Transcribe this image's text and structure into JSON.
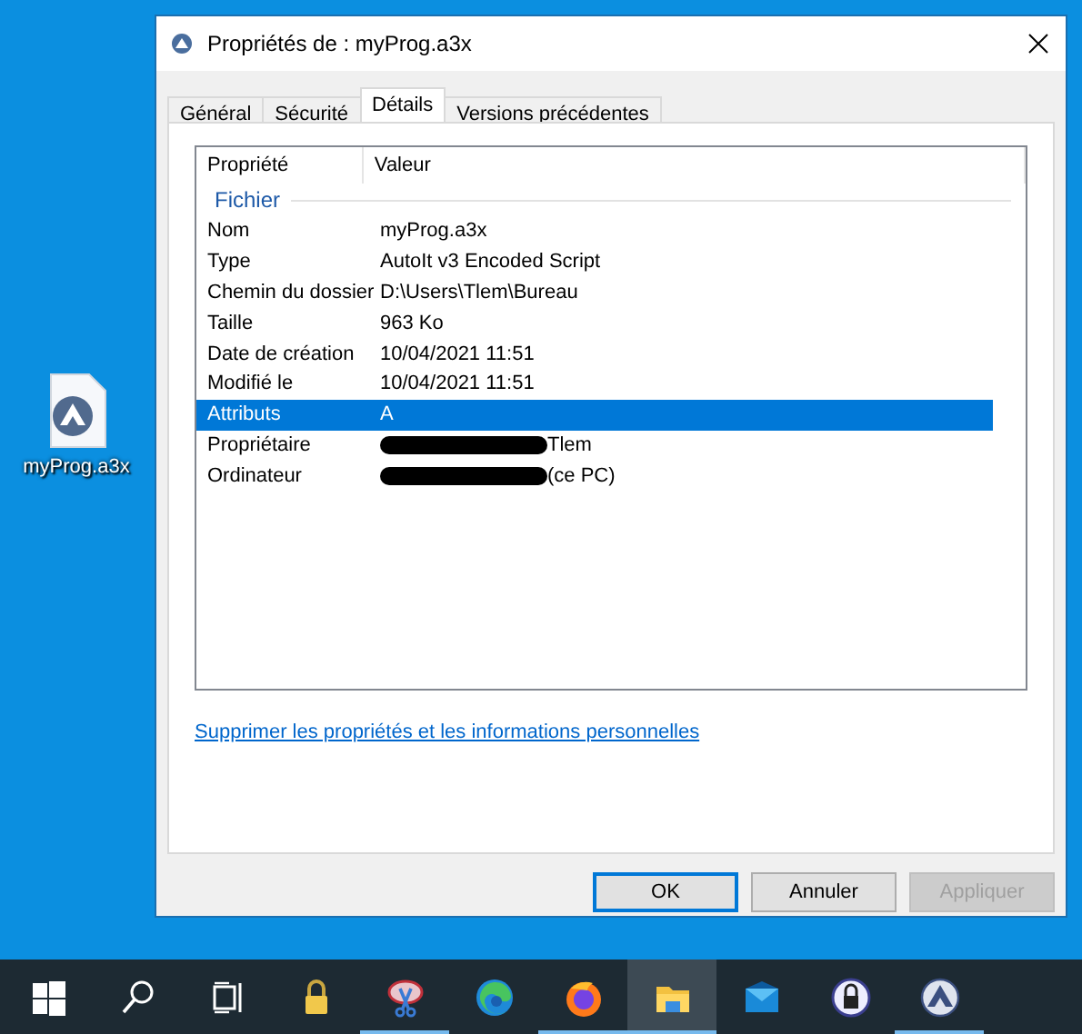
{
  "desktop_icon": {
    "label": "myProg.a3x"
  },
  "window": {
    "title": "Propriétés de : myProg.a3x"
  },
  "tabs": [
    {
      "label": "Général",
      "selected": false
    },
    {
      "label": "Sécurité",
      "selected": false
    },
    {
      "label": "Détails",
      "selected": true
    },
    {
      "label": "Versions précédentes",
      "selected": false
    }
  ],
  "table": {
    "columns": [
      "Propriété",
      "Valeur"
    ],
    "group": "Fichier",
    "rows": [
      {
        "name": "Nom",
        "value": "myProg.a3x",
        "selected": false,
        "redacted": false
      },
      {
        "name": "Type",
        "value": "AutoIt v3 Encoded Script",
        "selected": false,
        "redacted": false
      },
      {
        "name": "Chemin du dossier",
        "value": "D:\\Users\\Tlem\\Bureau",
        "selected": false,
        "redacted": false
      },
      {
        "name": "Taille",
        "value": "963 Ko",
        "selected": false,
        "redacted": false
      },
      {
        "name": "Date de création",
        "value": "10/04/2021 11:51",
        "selected": false,
        "redacted": false
      },
      {
        "name": "Modifié le",
        "value": "10/04/2021 11:51",
        "selected": false,
        "redacted": false
      },
      {
        "name": "Attributs",
        "value": "A",
        "selected": true,
        "redacted": false
      },
      {
        "name": "Propriétaire",
        "value": "Tlem",
        "selected": false,
        "redacted": true
      },
      {
        "name": "Ordinateur",
        "value": "(ce PC)",
        "selected": false,
        "redacted": true
      }
    ]
  },
  "link": "Supprimer les propriétés et les informations personnelles",
  "buttons": [
    {
      "label": "OK",
      "default": true,
      "disabled": false
    },
    {
      "label": "Annuler",
      "default": false,
      "disabled": false
    },
    {
      "label": "Appliquer",
      "default": false,
      "disabled": true
    }
  ],
  "taskbar": [
    {
      "kind": "start",
      "running": false,
      "active": false
    },
    {
      "kind": "search",
      "running": false,
      "active": false
    },
    {
      "kind": "taskview",
      "running": false,
      "active": false
    },
    {
      "kind": "lock",
      "running": false,
      "active": false
    },
    {
      "kind": "snip",
      "running": true,
      "active": false
    },
    {
      "kind": "edge",
      "running": false,
      "active": false
    },
    {
      "kind": "firefox",
      "running": true,
      "active": false
    },
    {
      "kind": "explorer",
      "running": true,
      "active": true
    },
    {
      "kind": "mail",
      "running": false,
      "active": false
    },
    {
      "kind": "keylock",
      "running": false,
      "active": false
    },
    {
      "kind": "autoit",
      "running": true,
      "active": false
    }
  ]
}
